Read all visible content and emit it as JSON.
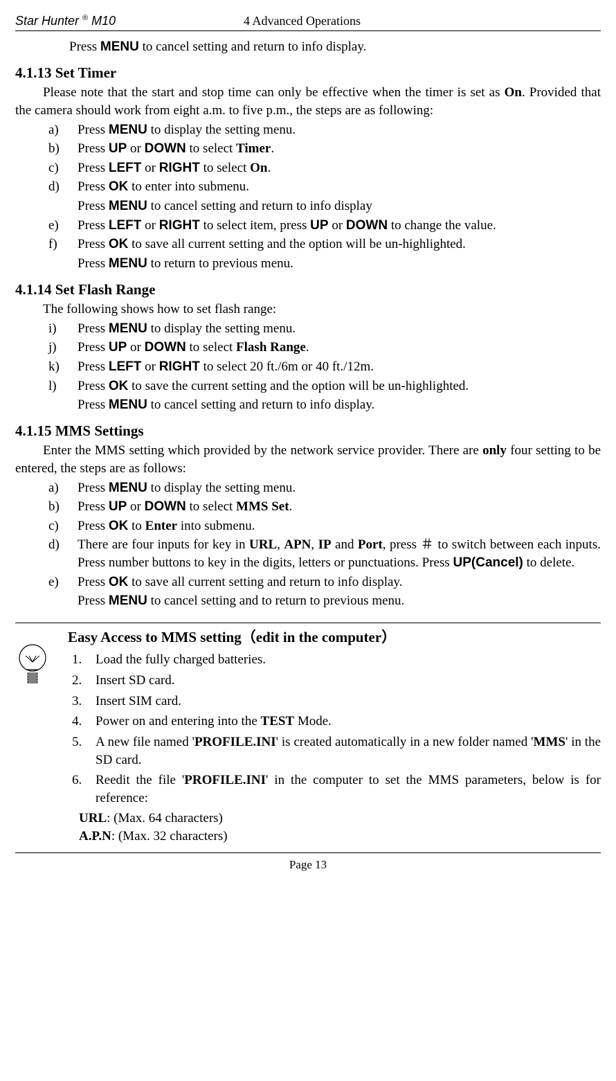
{
  "header": {
    "left_prefix": "Star Hunter ",
    "left_suffix": "M10",
    "reg": "®",
    "center": "4 Advanced Operations"
  },
  "topline": "to cancel setting and return to info display.",
  "topline_press": "Press ",
  "topline_menu": "MENU",
  "s4113": {
    "title": "4.1.13  Set Timer",
    "intro_1": "Please note that the start and stop time can only be effective when the timer is set as ",
    "intro_on": "On",
    "intro_2": ". Provided that the camera should work from eight a.m. to five p.m., the steps are as following:",
    "a_m": "a)",
    "a_1": "Press ",
    "a_2": " to display the setting menu.",
    "b_m": "b)",
    "b_1": "Press ",
    "b_2": " or ",
    "b_3": " to select ",
    "b_4": "Timer",
    "b_5": ".",
    "c_m": "c)",
    "c_1": "Press ",
    "c_2": " or ",
    "c_3": " to select ",
    "c_4": "On",
    "c_5": ".",
    "d_m": "d)",
    "d_1": "Press ",
    "d_2": " to enter into submenu.",
    "d_sub_1": "Press ",
    "d_sub_2": " to cancel setting and return to info display",
    "e_m": "e)",
    "e_1": "Press ",
    "e_2": " or ",
    "e_3": " to select item, press ",
    "e_4": " or ",
    "e_5": " to change the value.",
    "f_m": "f)",
    "f_1": "Press ",
    "f_2": " to save all current setting and the option will be un-highlighted.",
    "f_sub_1": "Press ",
    "f_sub_2": " to return to previous menu."
  },
  "s4114": {
    "title": "4.1.14  Set Flash Range",
    "intro": "The following shows how to set flash range:",
    "i_m": "i)",
    "i_1": "Press ",
    "i_2": " to display the setting menu.",
    "j_m": "j)",
    "j_1": "Press ",
    "j_2": " or ",
    "j_3": " to select ",
    "j_4": "Flash Range",
    "j_5": ".",
    "k_m": "k)",
    "k_1": "Press ",
    "k_2": " or ",
    "k_3": " to select 20 ft./6m or 40 ft./12m.",
    "l_m": "l)",
    "l_1": "Press ",
    "l_2": " to save the current setting and the option will be un-highlighted.",
    "l_sub_1": "Press ",
    "l_sub_2": " to cancel setting and return to info display."
  },
  "s4115": {
    "title": "4.1.15  MMS Settings",
    "intro_1": "Enter the MMS setting which provided by the network service provider. There are ",
    "intro_only": "only",
    "intro_2": " four setting to be entered, the steps are as follows:",
    "a_m": "a)",
    "a_1": "Press ",
    "a_2": " to display the setting menu.",
    "b_m": "b)",
    "b_1": "Press ",
    "b_2": " or ",
    "b_3": " to select ",
    "b_4": "MMS Set",
    "b_5": ".",
    "c_m": "c)",
    "c_1": "Press ",
    "c_2": " to ",
    "c_3": "Enter",
    "c_4": " into submenu.",
    "d_m": "d)",
    "d_1": "There are four inputs for key in ",
    "d_url": "URL",
    "d_c1": ", ",
    "d_apn": "APN",
    "d_c2": ", ",
    "d_ip": "IP",
    "d_and": " and ",
    "d_port": "Port",
    "d_2": ", press ",
    "d_hash": "＃",
    "d_3": " to switch between each inputs. Press number buttons to key in the digits, letters or punctuations. Press ",
    "d_upcancel": "UP(Cancel)",
    "d_4": " to delete.",
    "e_m": "e)",
    "e_1": "Press ",
    "e_2": " to save all current setting and return to info display.",
    "e_sub_1": "Press ",
    "e_sub_2": " to cancel setting and to return to previous menu."
  },
  "keys": {
    "menu": "MENU",
    "up": "UP",
    "down": "DOWN",
    "left": "LEFT",
    "right": "RIGHT",
    "ok": "OK"
  },
  "tip": {
    "title": "Easy Access to MMS setting（edit in the computer）",
    "n1": "1.",
    "t1": "Load the fully charged batteries.",
    "n2": "2.",
    "t2": "Insert SD card.",
    "n3": "3.",
    "t3": "Insert SIM card.",
    "n4": "4.",
    "t4_a": "Power on and entering into the ",
    "t4_b": "TEST",
    "t4_c": " Mode.",
    "n5": "5.",
    "t5_a": "A new file named '",
    "t5_b": "PROFILE.INI",
    "t5_c": "' is created automatically in a new folder named '",
    "t5_d": "MMS",
    "t5_e": "' in the SD card.",
    "n6": "6.",
    "t6_a": "Reedit the file '",
    "t6_b": "PROFILE.INI",
    "t6_c": "' in the computer to set the MMS parameters, below is for reference:",
    "sub1_a": "URL",
    "sub1_b": ": (Max. 64 characters)",
    "sub2_a": "A.P.N",
    "sub2_b": ": (Max. 32 characters)"
  },
  "footer": "Page 13"
}
